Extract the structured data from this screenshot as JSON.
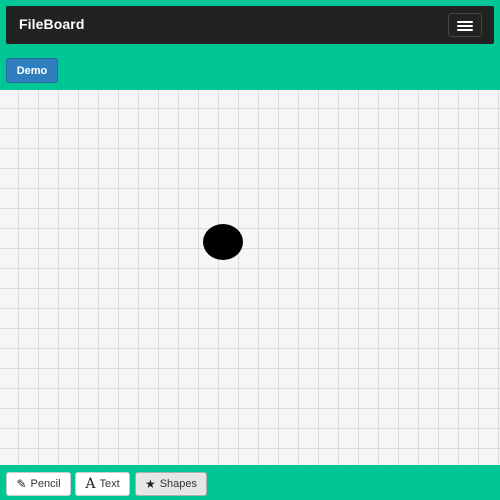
{
  "navbar": {
    "brand": "FileBoard",
    "menu_icon": "hamburger-icon"
  },
  "demo_button": {
    "label": "Demo",
    "color": "#2f7fbf"
  },
  "canvas": {
    "background": "#f6f6f6",
    "grid": true,
    "shapes": [
      {
        "type": "ellipse",
        "fill": "#000000"
      }
    ]
  },
  "toolbar": {
    "tools": [
      {
        "label": "Pencil",
        "icon": "pencil-icon",
        "glyph": "✎",
        "active": false
      },
      {
        "label": "Text",
        "icon": "text-icon",
        "glyph": "A",
        "active": false
      },
      {
        "label": "Shapes",
        "icon": "star-icon",
        "glyph": "★",
        "active": true
      }
    ]
  },
  "colors": {
    "accent": "#00c595",
    "navbar": "#222222"
  }
}
